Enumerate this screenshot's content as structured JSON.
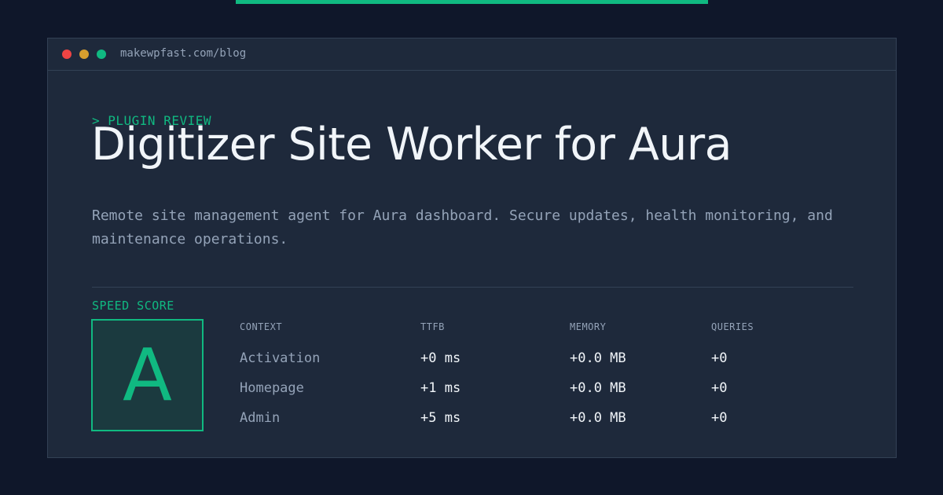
{
  "window": {
    "url": "makewpfast.com/blog"
  },
  "kicker": "> PLUGIN REVIEW",
  "title": "Digitizer Site Worker for Aura",
  "description": "Remote site management agent for Aura dashboard. Secure updates, health monitoring, and maintenance operations.",
  "score": {
    "label": "SPEED SCORE",
    "grade": "A"
  },
  "table": {
    "headers": [
      "CONTEXT",
      "TTFB",
      "MEMORY",
      "QUERIES"
    ],
    "rows": [
      [
        "Activation",
        "+0 ms",
        "+0.0 MB",
        "+0"
      ],
      [
        "Homepage",
        "+1 ms",
        "+0.0 MB",
        "+0"
      ],
      [
        "Admin",
        "+5 ms",
        "+0.0 MB",
        "+0"
      ]
    ]
  },
  "colors": {
    "accent": "#10b981",
    "background": "#0f172a",
    "panel": "#1e293b"
  }
}
